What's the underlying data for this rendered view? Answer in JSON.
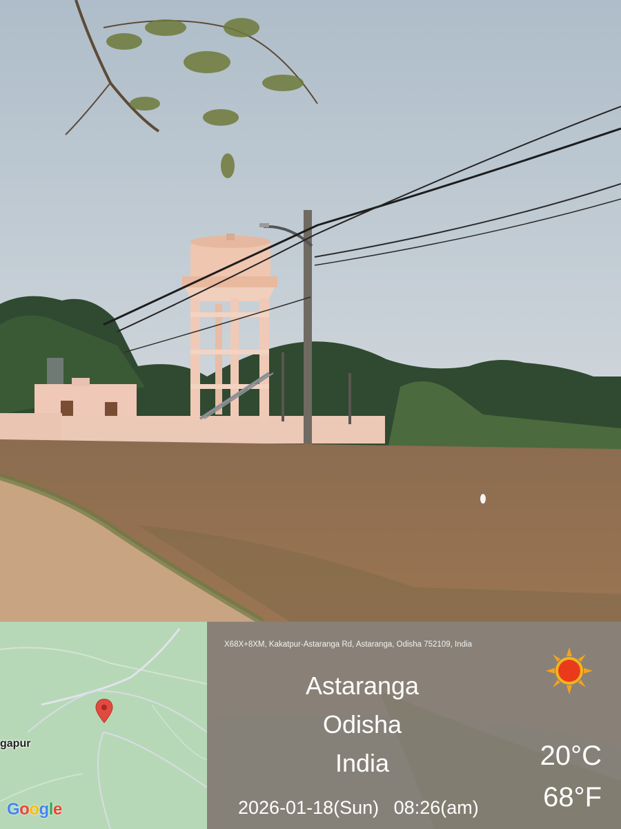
{
  "photo": {
    "scene_icon": "water-tower-field-photo",
    "colors": {
      "sky": "#bccad4",
      "tower": "#efc9b3",
      "ground": "#8a6a4e",
      "trees": "#2d4a2e"
    }
  },
  "map": {
    "place_label": "gapur",
    "pin_icon": "map-pin-icon",
    "logo": {
      "letters": [
        "G",
        "o",
        "o",
        "g",
        "l",
        "e"
      ],
      "colors": [
        "#4285F4",
        "#EA4335",
        "#FBBC05",
        "#4285F4",
        "#34A853",
        "#EA4335"
      ]
    }
  },
  "info": {
    "address": "X68X+8XM, Kakatpur-Astaranga Rd, Astaranga, Odisha 752109, India",
    "city": "Astaranga",
    "state": "Odisha",
    "country": "India",
    "temp_c": "20°C",
    "temp_f": "68°F",
    "date": "2026-01-18(Sun)",
    "time": "08:26(am)",
    "weather_icon": "sun-icon"
  }
}
